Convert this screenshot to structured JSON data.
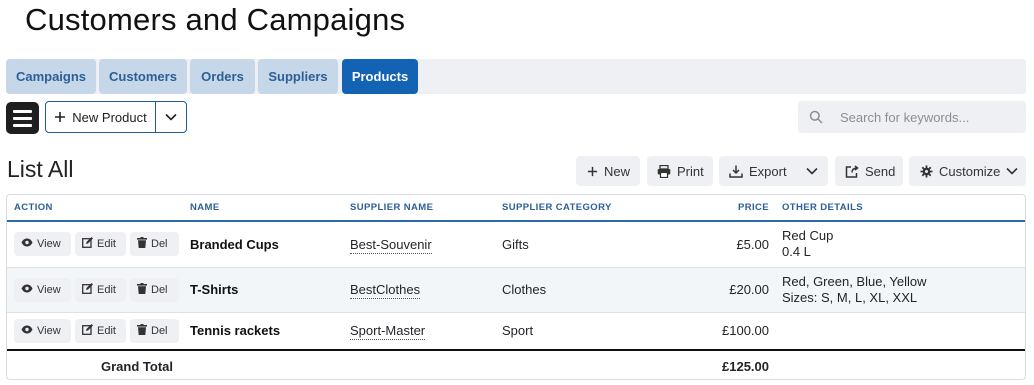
{
  "page": {
    "title": "Customers and Campaigns"
  },
  "tabs": [
    {
      "label": "Campaigns",
      "active": false
    },
    {
      "label": "Customers",
      "active": false
    },
    {
      "label": "Orders",
      "active": false
    },
    {
      "label": "Suppliers",
      "active": false
    },
    {
      "label": "Products",
      "active": true
    }
  ],
  "toolbar": {
    "new_product_label": "New Product",
    "search_placeholder": "Search for keywords...",
    "icons": {
      "menu": "hamburger-icon",
      "plus": "plus-icon",
      "dropdown": "chevron-down-icon",
      "search": "search-icon"
    }
  },
  "list": {
    "title": "List All",
    "buttons": {
      "new": "New",
      "print": "Print",
      "export": "Export",
      "send": "Send",
      "customize": "Customize"
    }
  },
  "table": {
    "headers": {
      "action": "ACTION",
      "name": "NAME",
      "supplier_name": "SUPPLIER NAME",
      "supplier_category": "SUPPLIER CATEGORY",
      "price": "PRICE",
      "other_details": "OTHER DETAILS"
    },
    "action_labels": {
      "view": "View",
      "edit": "Edit",
      "del": "Del"
    },
    "rows": [
      {
        "name": "Branded Cups",
        "supplier": "Best-Souvenir",
        "category": "Gifts",
        "price": "£5.00",
        "details": [
          "Red Cup",
          "0.4 L"
        ]
      },
      {
        "name": "T-Shirts",
        "supplier": "BestClothes",
        "category": "Clothes",
        "price": "£20.00",
        "details": [
          "Red, Green, Blue, Yellow",
          "Sizes: S, M, L, XL, XXL"
        ]
      },
      {
        "name": "Tennis rackets",
        "supplier": "Sport-Master",
        "category": "Sport",
        "price": "£100.00",
        "details": [
          "",
          ""
        ]
      }
    ],
    "footer": {
      "label": "Grand Total",
      "total": "£125.00"
    }
  },
  "colors": {
    "accent": "#1263b3",
    "tab_inactive": "#c5d7e8",
    "tab_text": "#2c5f96",
    "header_text": "#2c5f96"
  }
}
